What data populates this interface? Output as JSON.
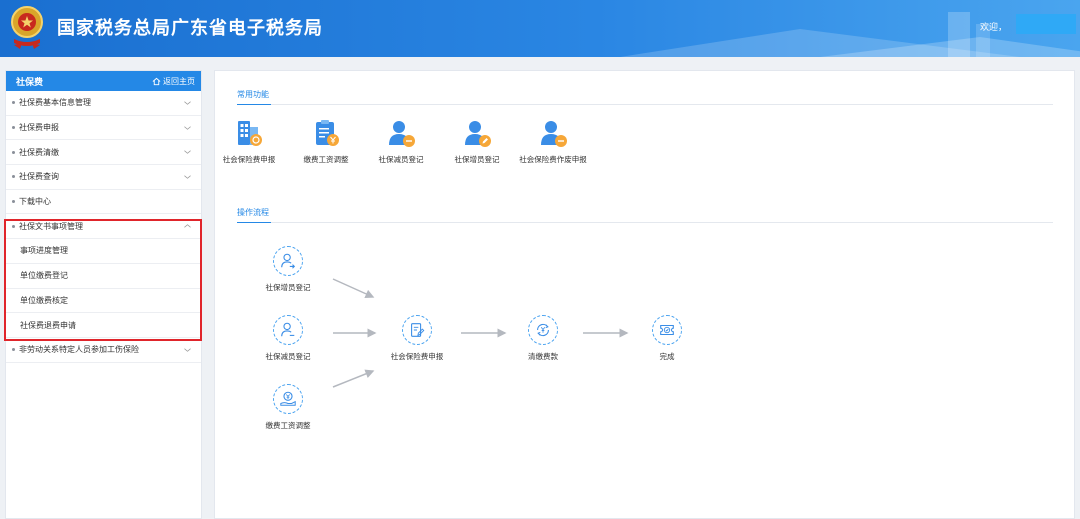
{
  "header": {
    "title": "国家税务总局广东省电子税务局",
    "welcome": "欢迎，",
    "emblem_icon": "tax-emblem-icon",
    "colors": {
      "gradient_start": "#1a6fd0",
      "gradient_end": "#4aa5ef"
    }
  },
  "sidebar": {
    "title": "社保费",
    "home_label": "返回主页",
    "items": [
      {
        "label": "社保费基本信息管理"
      },
      {
        "label": "社保费申报"
      },
      {
        "label": "社保费清缴"
      },
      {
        "label": "社保费查询"
      },
      {
        "label": "下载中心"
      },
      {
        "label": "社保文书事项管理",
        "expanded": true,
        "children": [
          "事项进度管理",
          "单位缴费登记",
          "单位缴费核定",
          "社保费退费申请"
        ]
      },
      {
        "label": "非劳动关系特定人员参加工伤保险"
      }
    ],
    "highlight_color": "#e0252b"
  },
  "main": {
    "common_title": "常用功能",
    "functions": [
      {
        "label": "社会保险费申报",
        "icon": "building-icon"
      },
      {
        "label": "缴费工资调整",
        "icon": "clipboard-yen-icon"
      },
      {
        "label": "社保减员登记",
        "icon": "user-minus-icon"
      },
      {
        "label": "社保增员登记",
        "icon": "user-edit-icon"
      },
      {
        "label": "社会保险费作废申报",
        "icon": "user-cancel-icon"
      }
    ],
    "flow_title": "操作流程",
    "flow": {
      "add": "社保增员登记",
      "reduce": "社保减员登记",
      "wage": "缴费工资调整",
      "declare": "社会保险费申报",
      "pay": "清缴费款",
      "done": "完成"
    },
    "accent_color": "#2488e6"
  }
}
